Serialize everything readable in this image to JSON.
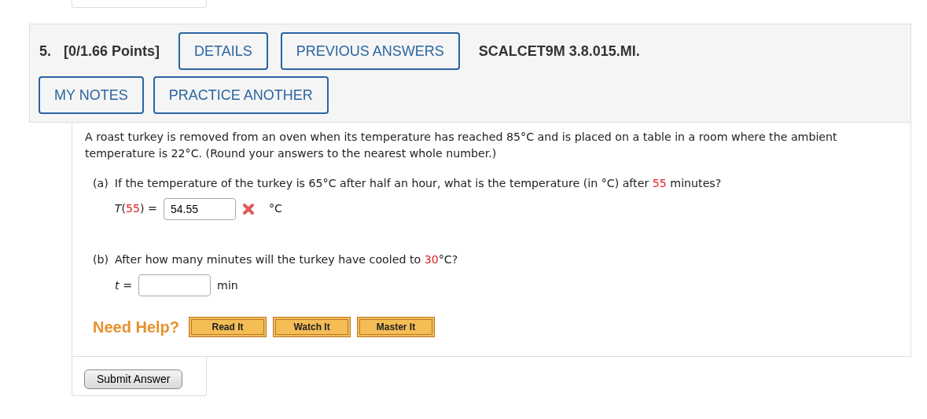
{
  "question": {
    "number": "5.",
    "points": "[0/1.66 Points]",
    "header_buttons": [
      {
        "label": "DETAILS"
      },
      {
        "label": "PREVIOUS ANSWERS"
      }
    ],
    "code": "SCALCET9M 3.8.015.MI.",
    "note_buttons": [
      {
        "label": "MY NOTES"
      },
      {
        "label": "PRACTICE ANOTHER"
      }
    ]
  },
  "intro": "A roast turkey is removed from an oven when its temperature has reached 85°C and is placed on a table in a room where the ambient temperature is 22°C. (Round your answers to the nearest whole number.)",
  "parts": [
    {
      "label": "(a)",
      "prompt": [
        {
          "text": "If the temperature of the turkey is 65°C after half an hour, what is the temperature (in °C) after ",
          "highlight": false
        },
        {
          "text": "55",
          "highlight": true
        },
        {
          "text": " minutes?",
          "highlight": false
        }
      ],
      "lhs": [
        {
          "text": "T",
          "italic": true,
          "highlight": false
        },
        {
          "text": "(",
          "highlight": false
        },
        {
          "text": "55",
          "highlight": true
        },
        {
          "text": ") =",
          "highlight": false
        }
      ],
      "value": "54.55",
      "marked_incorrect": true,
      "unit": "°C"
    },
    {
      "label": "(b)",
      "prompt": [
        {
          "text": "After how many minutes will the turkey have cooled to ",
          "highlight": false
        },
        {
          "text": "30",
          "highlight": true
        },
        {
          "text": "°C?",
          "highlight": false
        }
      ],
      "lhs": [
        {
          "text": "t",
          "italic": true,
          "highlight": false
        },
        {
          "text": " =",
          "highlight": false
        }
      ],
      "marked_incorrect": false,
      "unit": "min"
    }
  ],
  "help": {
    "title": "Need Help?",
    "buttons": [
      {
        "label": "Read It"
      },
      {
        "label": "Watch It"
      },
      {
        "label": "Master It"
      }
    ]
  },
  "submit": "Submit Answer"
}
